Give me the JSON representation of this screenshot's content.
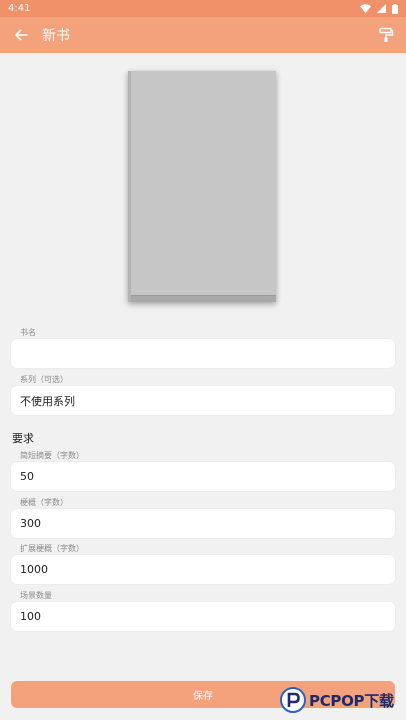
{
  "status_bar": {
    "time": "4:41"
  },
  "app_bar": {
    "title": "新书"
  },
  "form": {
    "book_name": {
      "label": "书名",
      "value": ""
    },
    "series": {
      "label": "系列（可选）",
      "value": "不使用系列"
    },
    "requirements_title": "要求",
    "short_summary": {
      "label": "简短摘要（字数）",
      "value": "50"
    },
    "outline": {
      "label": "梗概（字数）",
      "value": "300"
    },
    "extended_outline": {
      "label": "扩展梗概（字数）",
      "value": "1000"
    },
    "scene_count": {
      "label": "场景数量",
      "value": "100"
    }
  },
  "actions": {
    "save_label": "保存"
  },
  "colors": {
    "accent": "#f4a27b",
    "status_bar": "#f0916a",
    "background": "#f1f1f1"
  },
  "watermark": {
    "text": "PCPOP下载"
  }
}
